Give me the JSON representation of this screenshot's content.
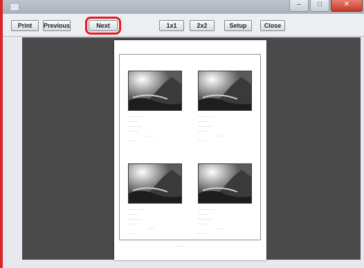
{
  "window": {
    "title": ""
  },
  "toolbar": {
    "print": "Print",
    "previous": "Previous",
    "next": "Next",
    "one_by_one": "1x1",
    "two_by_two": "2x2",
    "setup": "Setup",
    "close": "Close"
  },
  "colors": {
    "highlight": "#e51b23",
    "viewer_bg": "#4a4a4a",
    "accent": "#d9262b"
  }
}
